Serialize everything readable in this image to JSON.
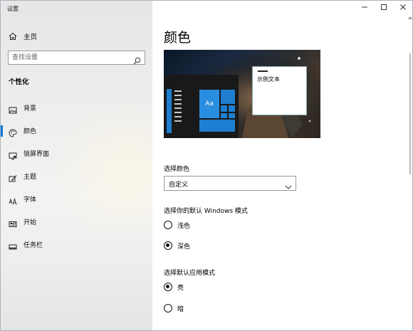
{
  "window": {
    "title": "设置"
  },
  "sidebar": {
    "home_label": "主页",
    "search_placeholder": "查找设置",
    "section": "个性化",
    "items": [
      {
        "label": "背景",
        "icon": "picture-icon"
      },
      {
        "label": "颜色",
        "icon": "palette-icon",
        "selected": true
      },
      {
        "label": "锁屏界面",
        "icon": "lock-screen-icon"
      },
      {
        "label": "主题",
        "icon": "theme-brush-icon"
      },
      {
        "label": "字体",
        "icon": "font-icon"
      },
      {
        "label": "开始",
        "icon": "start-menu-icon"
      },
      {
        "label": "任务栏",
        "icon": "taskbar-icon"
      }
    ]
  },
  "content": {
    "title": "颜色",
    "preview": {
      "tile_text": "Aa",
      "sample_text": "示例文本"
    },
    "choose_color": {
      "label": "选择颜色",
      "value": "自定义"
    },
    "windows_mode": {
      "label": "选择你的默认 Windows 模式",
      "options": [
        {
          "label": "浅色",
          "checked": false
        },
        {
          "label": "深色",
          "checked": true
        }
      ]
    },
    "app_mode": {
      "label": "选择默认应用模式",
      "options": [
        {
          "label": "亮",
          "checked": true
        },
        {
          "label": "暗",
          "checked": false
        }
      ]
    }
  },
  "colors": {
    "accent": "#0078d7",
    "tile": "#1e7fd0",
    "start_bg": "#191919"
  }
}
